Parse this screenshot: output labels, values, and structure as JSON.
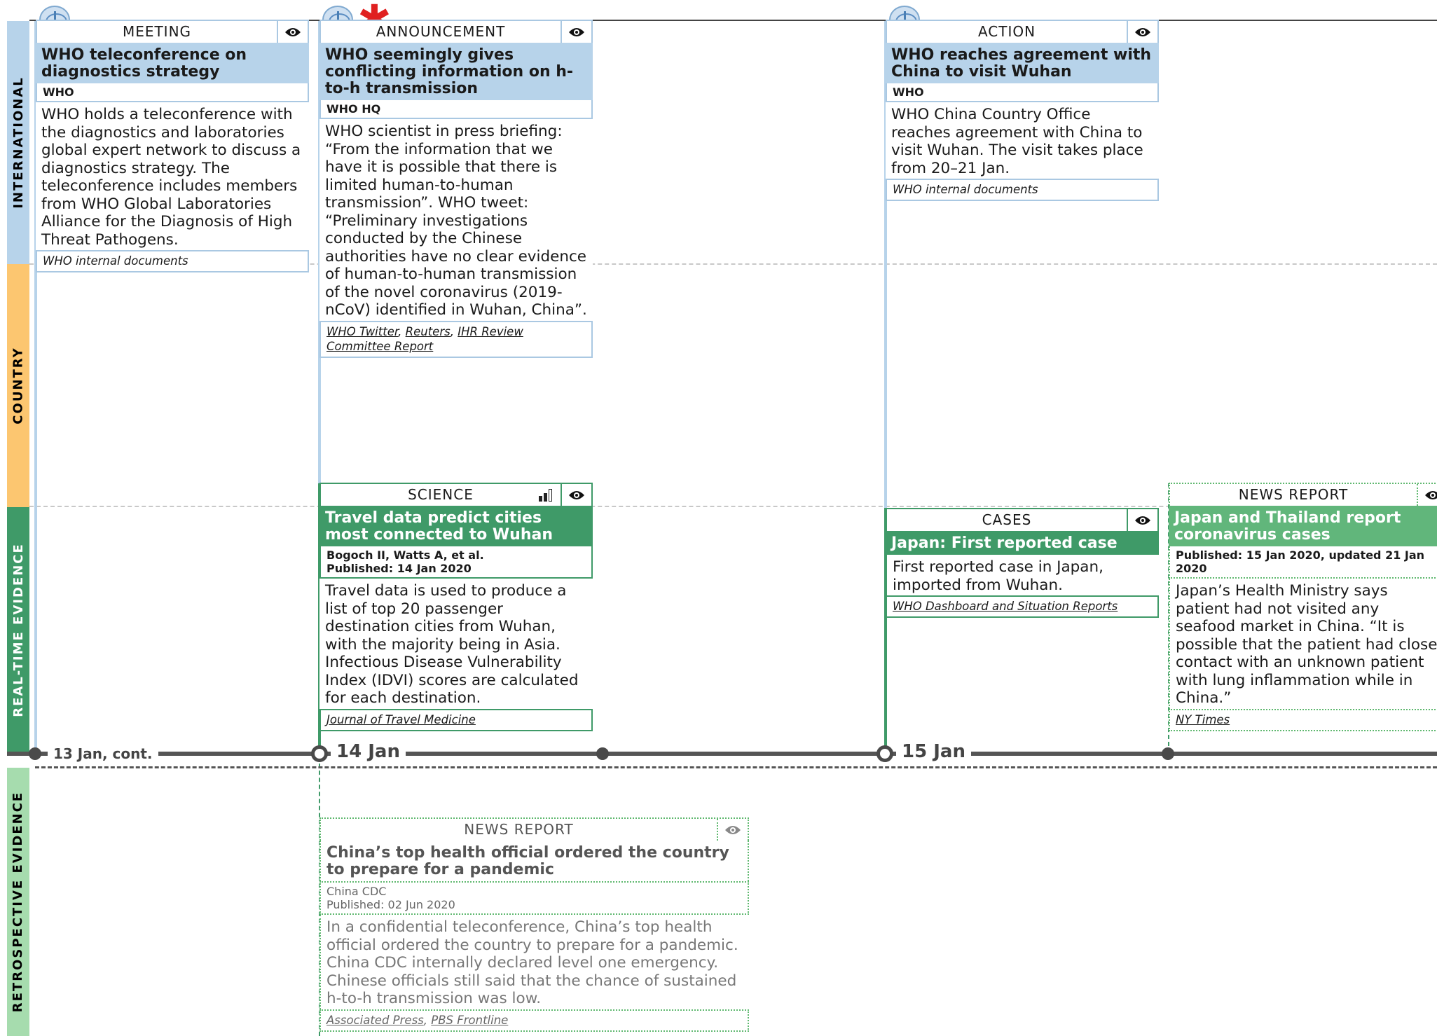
{
  "lanes": {
    "international": "INTERNATIONAL",
    "country": "COUNTRY",
    "realtime": "REAL-TIME EVIDENCE",
    "retrospective": "RETROSPECTIVE EVIDENCE"
  },
  "colors": {
    "international": "#b7d3ea",
    "country": "#fcc670",
    "realtime": "#3f9a68",
    "retrospective": "#a6dcae"
  },
  "timeline": {
    "labels": [
      "13 Jan, cont.",
      "14 Jan",
      "15 Jan"
    ]
  },
  "cards": {
    "meeting": {
      "type": "MEETING",
      "title": "WHO teleconference on diagnostics strategy",
      "who": "WHO",
      "body": "WHO holds a teleconference with the diagnostics and laboratories global expert network to discuss a diagnostics strategy. The teleconference includes members from WHO Global Laboratories Alliance for the Diagnosis of High Threat Pathogens.",
      "source": "WHO internal documents",
      "icon": "who-logo-icon"
    },
    "announcement": {
      "type": "ANNOUNCEMENT",
      "title": "WHO seemingly gives conflicting information on h-to-h transmission",
      "who": "WHO HQ",
      "body": "WHO scientist in press briefing: “From the information that we have it is possible that there is limited human-to-human transmission”. WHO tweet: “Preliminary investigations conducted by the Chinese authorities have no clear evidence of human-to-human transmission of the novel coronavirus (2019-nCoV) identified in Wuhan, China”.",
      "sources": [
        "WHO Twitter",
        "Reuters",
        "IHR Review Committee Report"
      ],
      "icon": "who-logo-icon",
      "flag": "red-asterisk-icon"
    },
    "action": {
      "type": "ACTION",
      "title": "WHO reaches agreement with China to visit Wuhan",
      "who": "WHO",
      "body": "WHO China Country Office reaches agreement with China to visit Wuhan. The visit takes place from 20–21 Jan.",
      "source": "WHO internal documents",
      "icon": "who-logo-icon"
    },
    "science": {
      "type": "SCIENCE",
      "title": "Travel data predict cities most connected to Wuhan",
      "who_line1": "Bogoch II, Watts A, et al.",
      "who_line2": "Published: 14 Jan 2020",
      "body": "Travel data is used to produce a list of top 20 passenger destination cities from Wuhan, with the majority being in Asia. Infectious Disease Vulnerability Index (IDVI) scores are calculated for each destination.",
      "source": "Journal of Travel Medicine",
      "icon": "signal-bars-icon"
    },
    "cases": {
      "type": "CASES",
      "title": "Japan: First reported case",
      "body": "First reported case in Japan, imported from Wuhan.",
      "source": "WHO Dashboard and Situation Reports"
    },
    "news1": {
      "type": "NEWS REPORT",
      "title": "Japan and Thailand report coronavirus cases",
      "who": "Published: 15 Jan 2020, updated 21 Jan 2020",
      "body": "Japan’s Health Ministry says patient had not visited any seafood market in China. “It is possible that the patient had close contact with an unknown patient with lung inflammation while in China.”",
      "source": "NY Times"
    },
    "news2": {
      "type": "NEWS REPORT",
      "title": "China’s top health official ordered the country to prepare for a pandemic",
      "who_line1": "China CDC",
      "who_line2": "Published: 02 Jun 2020",
      "body": "In a confidential teleconference, China’s top health official ordered the country to prepare for a pandemic. China CDC internally declared level one emergency. Chinese officials still said that the chance of sustained h-to-h transmission was low.",
      "sources": [
        "Associated Press",
        "PBS Frontline"
      ]
    }
  }
}
